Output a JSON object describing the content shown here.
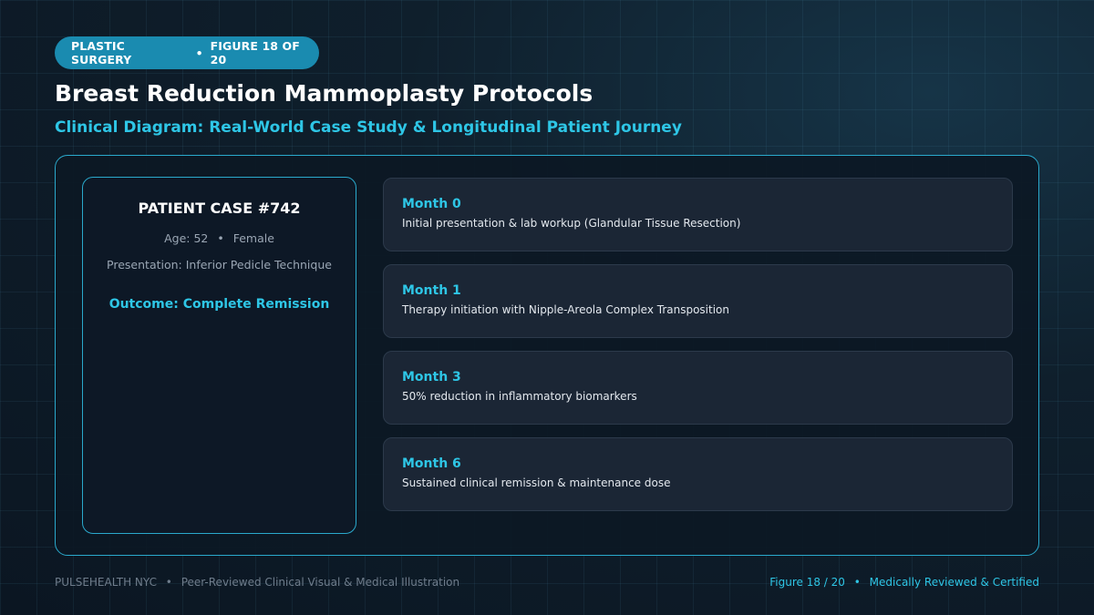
{
  "header": {
    "category": "PLASTIC SURGERY",
    "figure_label": "FIGURE 18 OF 20",
    "separator": "•",
    "title": "Breast Reduction Mammoplasty Protocols",
    "subtitle": "Clinical Diagram: Real-World Case Study & Longitudinal Patient Journey"
  },
  "case": {
    "title": "PATIENT CASE #742",
    "age": "Age: 52",
    "sex": "Female",
    "separator": "•",
    "presentation": "Presentation: Inferior Pedicle Technique",
    "outcome": "Outcome: Complete Remission"
  },
  "timeline": [
    {
      "month": "Month 0",
      "description": "Initial presentation & lab workup (Glandular Tissue Resection)"
    },
    {
      "month": "Month 1",
      "description": "Therapy initiation with Nipple-Areola Complex Transposition"
    },
    {
      "month": "Month 3",
      "description": "50% reduction in inflammatory biomarkers"
    },
    {
      "month": "Month 6",
      "description": "Sustained clinical remission & maintenance dose"
    }
  ],
  "footer": {
    "brand": "PULSEHEALTH NYC",
    "tagline": "Peer-Reviewed Clinical Visual & Medical Illustration",
    "figure": "Figure 18 / 20",
    "certification": "Medically Reviewed & Certified",
    "separator": "•"
  },
  "colors": {
    "accent": "#2ec6e6",
    "pill": "#1a8bb0",
    "background": "#0f1f2c"
  }
}
